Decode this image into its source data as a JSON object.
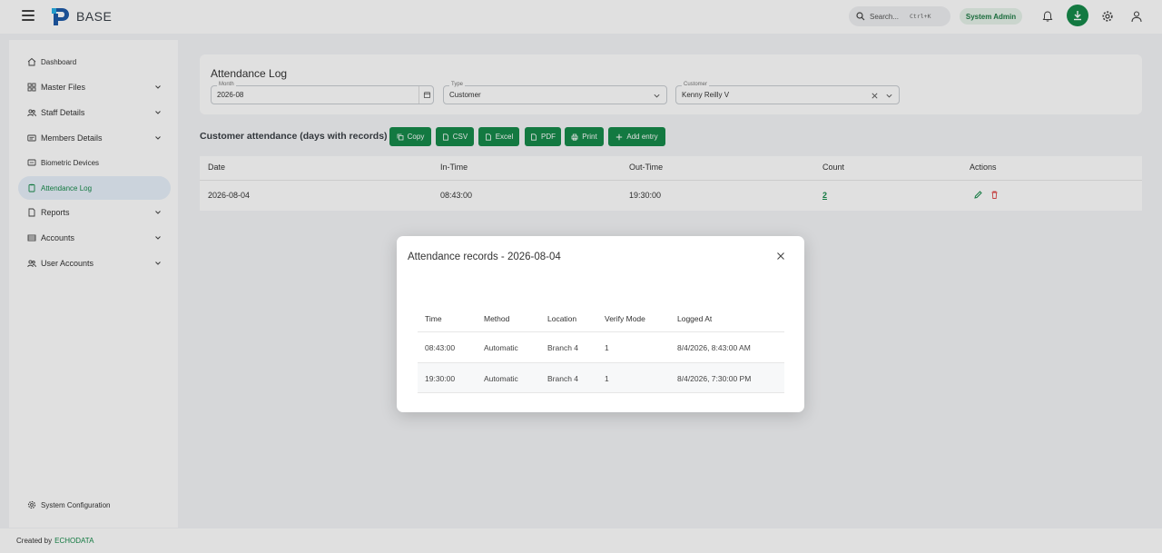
{
  "app": {
    "brand": "BASE"
  },
  "topbar": {
    "search_label": "Search...",
    "search_shortcut": "Ctrl+K",
    "role": "System Admin"
  },
  "sidebar": {
    "items": [
      {
        "label": "Dashboard"
      },
      {
        "label": "Master Files"
      },
      {
        "label": "Staff Details"
      },
      {
        "label": "Members Details"
      },
      {
        "label": "Biometric Devices"
      },
      {
        "label": "Attendance Log"
      },
      {
        "label": "Reports"
      },
      {
        "label": "Accounts"
      },
      {
        "label": "User Accounts"
      }
    ],
    "bottom_item": "System Configuration"
  },
  "page": {
    "title": "Attendance Log",
    "filters": {
      "month": {
        "label": "Month",
        "value": "2026-08"
      },
      "type": {
        "label": "Type",
        "value": "Customer"
      },
      "customer": {
        "label": "Customer",
        "value": "Kenny Reilly V"
      }
    },
    "section_title": "Customer attendance (days with records)",
    "toolbar": {
      "copy": "Copy",
      "csv": "CSV",
      "excel": "Excel",
      "pdf": "PDF",
      "print": "Print",
      "add": "Add entry"
    },
    "table": {
      "headers": [
        "Date",
        "In-Time",
        "Out-Time",
        "Count",
        "Actions"
      ],
      "rows": [
        {
          "date": "2026-08-04",
          "in_time": "08:43:00",
          "out_time": "19:30:00",
          "count": "2"
        }
      ]
    }
  },
  "modal": {
    "title": "Attendance records - 2026-08-04",
    "headers": [
      "Time",
      "Method",
      "Location",
      "Verify Mode",
      "Logged At"
    ],
    "rows": [
      {
        "time": "08:43:00",
        "method": "Automatic",
        "location": "Branch 4",
        "verify_mode": "1",
        "logged_at": "8/4/2026, 8:43:00 AM"
      },
      {
        "time": "19:30:00",
        "method": "Automatic",
        "location": "Branch 4",
        "verify_mode": "1",
        "logged_at": "8/4/2026, 7:30:00 PM"
      }
    ]
  },
  "footer": {
    "prefix": "Created by",
    "company": "ECHODATA"
  },
  "colors": {
    "accent": "#168a4a",
    "danger": "#e04848",
    "active_bg": "#e8f1fb"
  }
}
